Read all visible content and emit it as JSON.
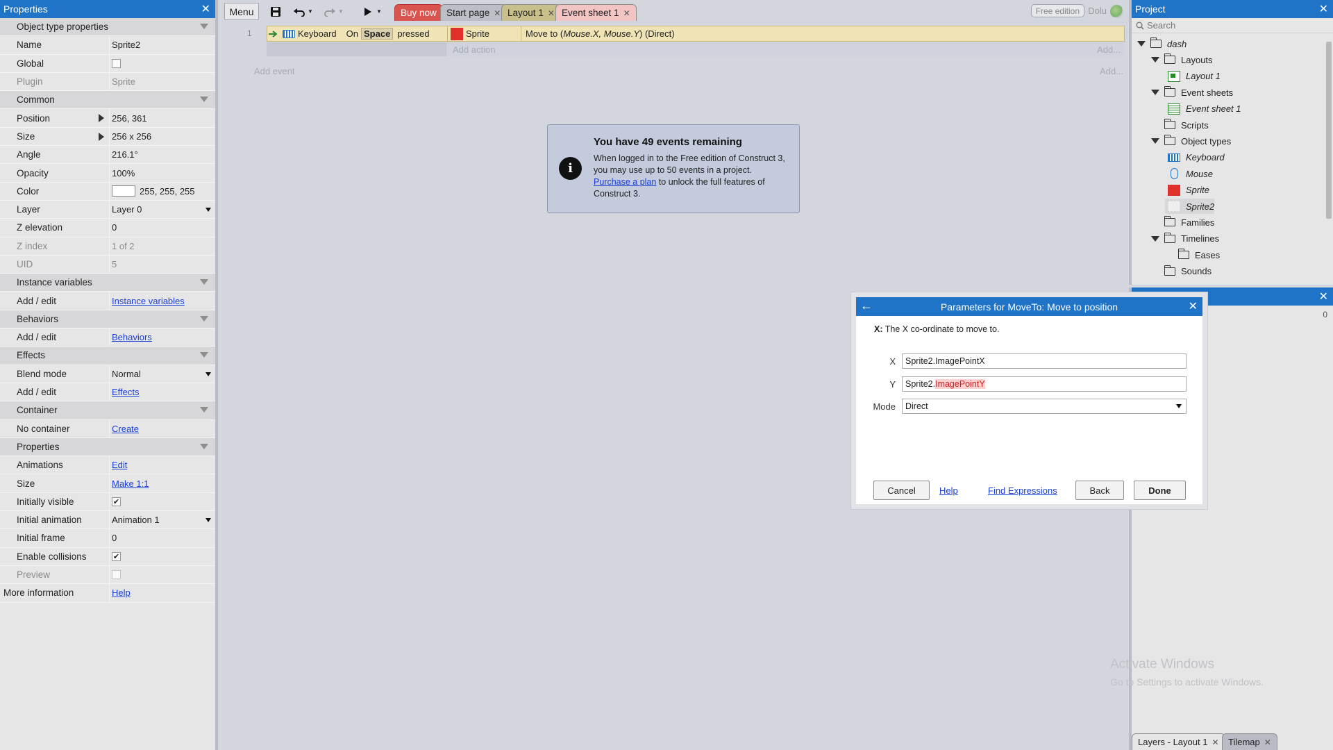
{
  "properties": {
    "title": "Properties",
    "rows": [
      {
        "label": "Object type properties",
        "kind": "section-top"
      },
      {
        "label": "Name",
        "value": "Sprite2"
      },
      {
        "label": "Global",
        "kind": "check",
        "checked": false
      },
      {
        "label": "Plugin",
        "value": "Sprite",
        "dim": true
      },
      {
        "label": "Common",
        "kind": "section"
      },
      {
        "label": "Position",
        "value": "256, 361",
        "expand": true
      },
      {
        "label": "Size",
        "value": "256 x 256",
        "expand": true
      },
      {
        "label": "Angle",
        "value": "216.1°"
      },
      {
        "label": "Opacity",
        "value": "100%"
      },
      {
        "label": "Color",
        "value": "255, 255, 255",
        "swatch": "#ffffff"
      },
      {
        "label": "Layer",
        "value": "Layer 0",
        "dropdown": true
      },
      {
        "label": "Z elevation",
        "value": "0"
      },
      {
        "label": "Z index",
        "value": "1 of 2",
        "dim": true
      },
      {
        "label": "UID",
        "value": "5",
        "dim": true
      },
      {
        "label": "Instance variables",
        "kind": "section"
      },
      {
        "label": "Add / edit",
        "value": "Instance variables",
        "link": true
      },
      {
        "label": "Behaviors",
        "kind": "section"
      },
      {
        "label": "Add / edit",
        "value": "Behaviors",
        "link": true
      },
      {
        "label": "Effects",
        "kind": "section"
      },
      {
        "label": "Blend mode",
        "value": "Normal",
        "dropdown": true
      },
      {
        "label": "Add / edit",
        "value": "Effects",
        "link": true
      },
      {
        "label": "Container",
        "kind": "section"
      },
      {
        "label": "No container",
        "value": "Create",
        "link": true
      },
      {
        "label": "Properties",
        "kind": "section"
      },
      {
        "label": "Animations",
        "value": "Edit",
        "link": true
      },
      {
        "label": "Size",
        "value": "Make 1:1",
        "link": true
      },
      {
        "label": "Initially visible",
        "kind": "check",
        "checked": true
      },
      {
        "label": "Initial animation",
        "value": "Animation 1",
        "dropdown": true
      },
      {
        "label": "Initial frame",
        "value": "0"
      },
      {
        "label": "Enable collisions",
        "kind": "check",
        "checked": true
      },
      {
        "label": "Preview",
        "kind": "check",
        "checked": false,
        "dim": true
      },
      {
        "label": "More information",
        "value": "Help",
        "link": true,
        "top": true
      }
    ]
  },
  "toolbar": {
    "menu_label": "Menu",
    "tabs": [
      "Buy now",
      "Start page",
      "Layout 1",
      "Event sheet 1"
    ],
    "free_edition": "Free edition",
    "user": "Dolu"
  },
  "event_sheet": {
    "event_number": "1",
    "condition_object": "Keyboard",
    "condition_on": "On",
    "condition_key": "Space",
    "condition_suffix": "pressed",
    "action_object": "Sprite",
    "action_prefix": "Move to (",
    "action_params": "Mouse.X, Mouse.Y",
    "action_suffix": ") (Direct)",
    "add_action": "Add action",
    "add_dots_1": "Add...",
    "add_event": "Add event",
    "add_dots_2": "Add..."
  },
  "notice": {
    "title": "You have 49 events remaining",
    "body_1": "When logged in to the Free edition of Construct 3, you may use up to 50 events in a project.",
    "link": "Purchase a plan",
    "body_2": " to unlock the full features of Construct 3."
  },
  "project": {
    "title": "Project",
    "search_placeholder": "Search",
    "tree": [
      {
        "label": "dash",
        "type": "folder",
        "open": true,
        "italic": true
      },
      {
        "label": "Layouts",
        "type": "folder",
        "open": true
      },
      {
        "label": "Layout 1",
        "type": "layout",
        "italic": true
      },
      {
        "label": "Event sheets",
        "type": "folder",
        "open": true
      },
      {
        "label": "Event sheet 1",
        "type": "sheet",
        "italic": true
      },
      {
        "label": "Scripts",
        "type": "folder"
      },
      {
        "label": "Object types",
        "type": "folder",
        "open": true
      },
      {
        "label": "Keyboard",
        "type": "keyboard",
        "italic": true
      },
      {
        "label": "Mouse",
        "type": "mouse",
        "italic": true
      },
      {
        "label": "Sprite",
        "type": "sprite",
        "italic": true
      },
      {
        "label": "Sprite2",
        "type": "sprite2",
        "italic": true
      },
      {
        "label": "Families",
        "type": "folder"
      },
      {
        "label": "Timelines",
        "type": "folder",
        "open": true
      },
      {
        "label": "Eases",
        "type": "folder"
      },
      {
        "label": "Sounds",
        "type": "folder"
      }
    ]
  },
  "layers_panel": {
    "value": "0",
    "tabs": [
      "Layers - Layout 1",
      "Tilemap"
    ]
  },
  "watermark": {
    "line1": "Activate Windows",
    "line2": "Go to Settings to activate Windows."
  },
  "dialog": {
    "title": "Parameters for MoveTo: Move to position",
    "desc_bold": "X:",
    "desc": " The X co-ordinate to move to.",
    "x_label": "X",
    "x_value": "Sprite2.ImagePointX",
    "y_label": "Y",
    "y_prefix": "Sprite2.",
    "y_error": "ImagePointY",
    "mode_label": "Mode",
    "mode_value": "Direct",
    "cancel": "Cancel",
    "help": "Help",
    "find": "Find Expressions",
    "back": "Back",
    "done": "Done"
  },
  "colors": {
    "accent": "#1f74c8",
    "event_bg": "#f0e3b6",
    "sprite_red": "#e0302b",
    "error_bg": "#ffd0d0"
  }
}
